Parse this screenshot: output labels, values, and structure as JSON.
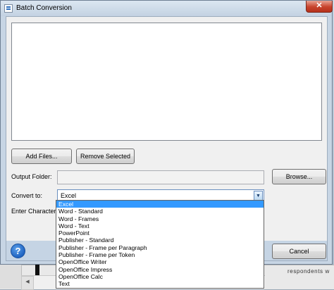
{
  "window": {
    "title": "Batch Conversion",
    "close_glyph": "✕"
  },
  "buttons": {
    "add_files": "Add Files...",
    "remove_selected": "Remove Selected",
    "browse": "Browse...",
    "cancel": "Cancel"
  },
  "output_folder": {
    "label": "Output Folder:",
    "value": ""
  },
  "convert_to": {
    "label": "Convert to:",
    "selected": "Excel",
    "options": [
      "Excel",
      "Word - Standard",
      "Word - Frames",
      "Word - Text",
      "PowerPoint",
      "Publisher - Standard",
      "Publisher - Frame per Paragraph",
      "Publisher - Frame per Token",
      "OpenOffice Writer",
      "OpenOffice Impress",
      "OpenOffice Calc",
      "Text"
    ]
  },
  "enter_characters": {
    "label": "Enter Characters"
  },
  "help": {
    "glyph": "?"
  },
  "background": {
    "right_text": "respondents w"
  },
  "colors": {
    "selection": "#3399ff",
    "close": "#c7432c"
  }
}
